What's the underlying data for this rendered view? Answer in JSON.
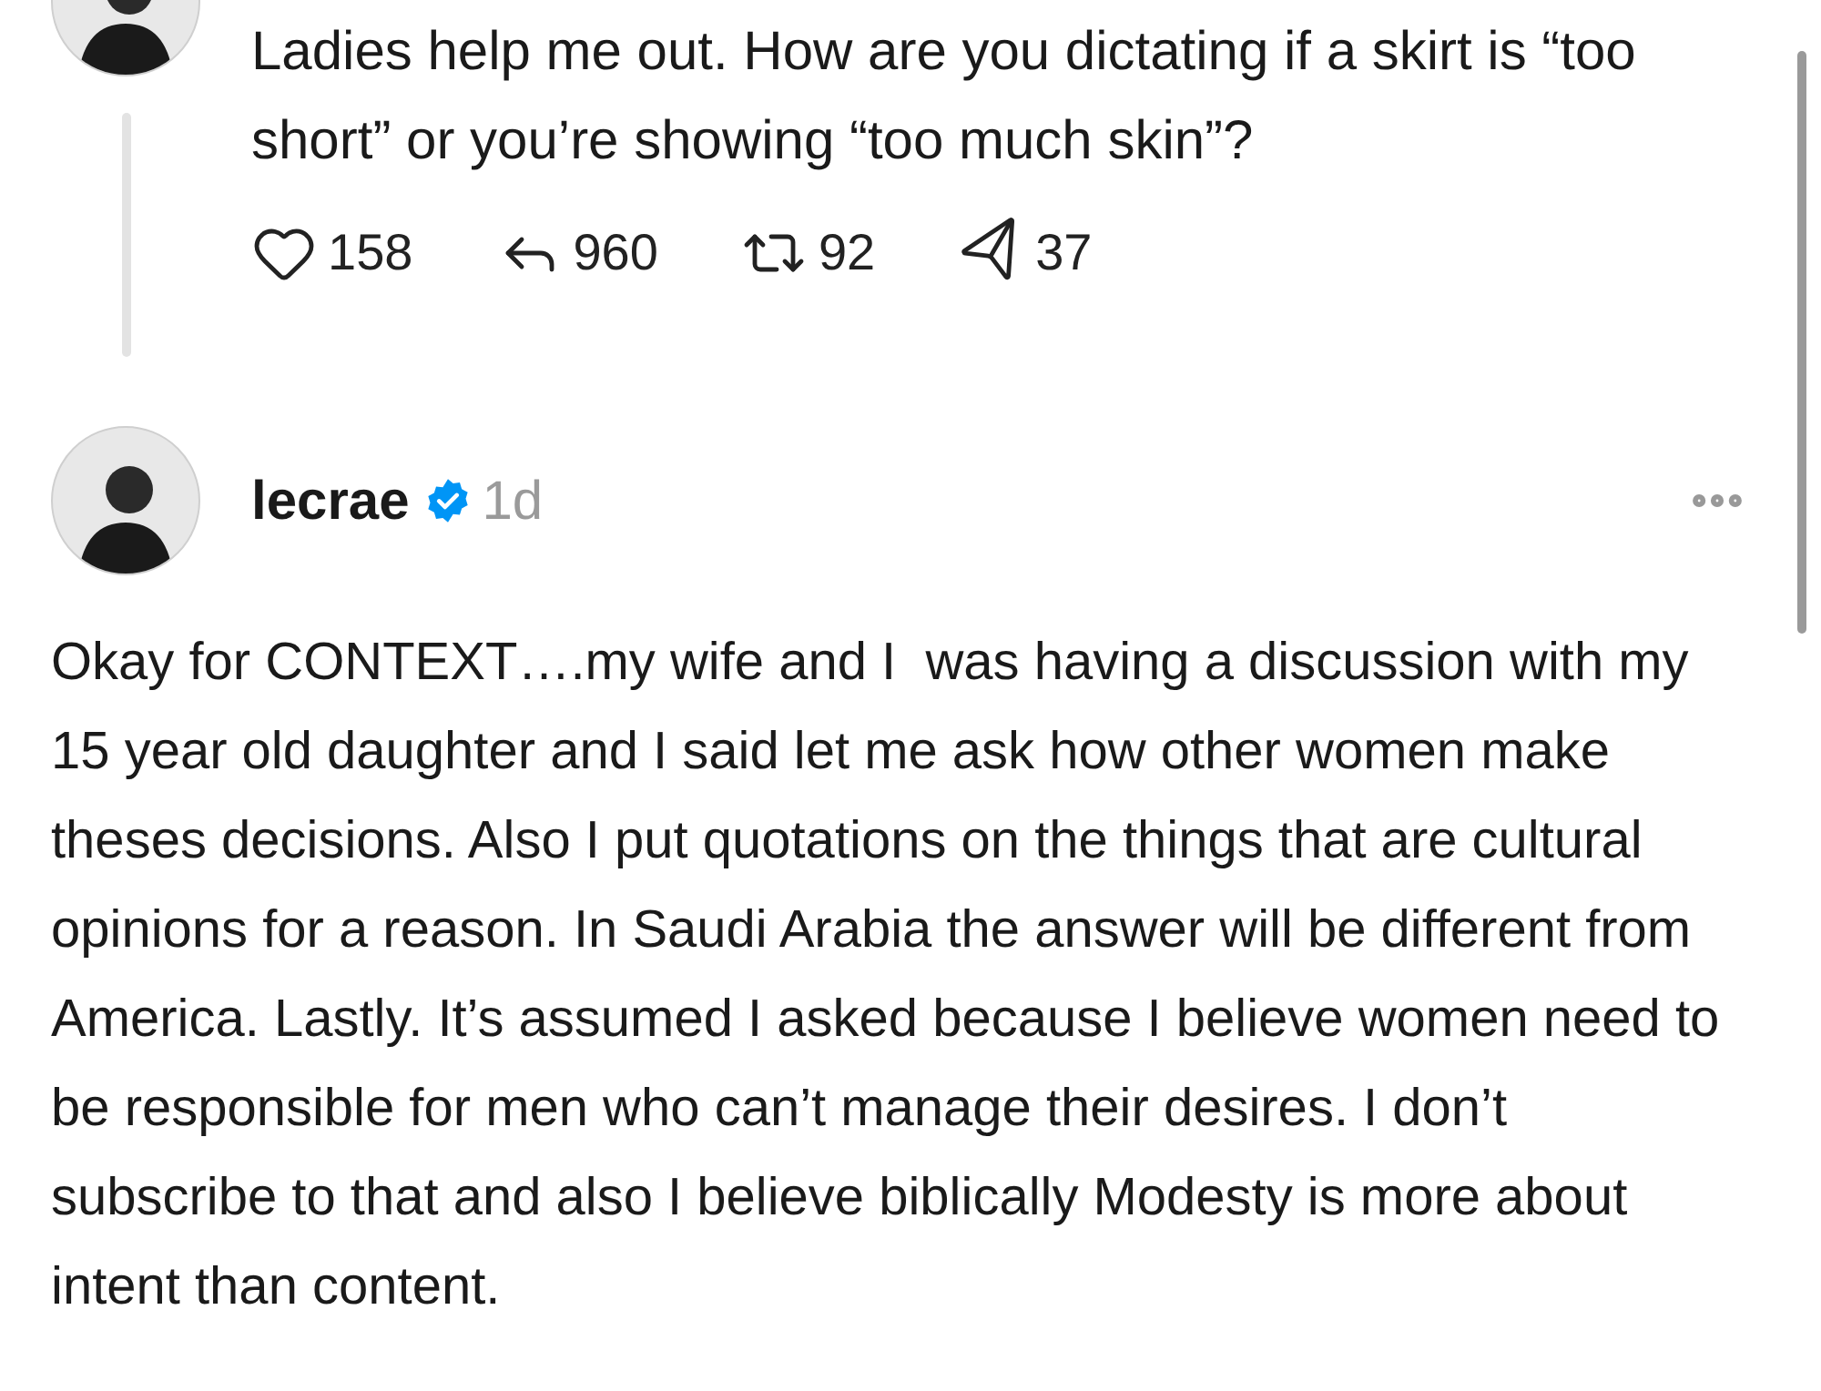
{
  "parent_post": {
    "text": "Ladies help me out. How are you dictating if a skirt is “too short” or you’re showing “too much skin”?",
    "actions": [
      {
        "kind": "like",
        "count": "158"
      },
      {
        "kind": "reply",
        "count": "960"
      },
      {
        "kind": "repost",
        "count": "92"
      },
      {
        "kind": "share",
        "count": "37"
      }
    ]
  },
  "reply_post": {
    "username": "lecrae",
    "verified": true,
    "time": "1d",
    "text": "Okay for CONTEXT….my wife and I  was having a discussion with my 15 year old daughter and I said let me ask how other women make theses decisions. Also I put quotations on the things that are cultural opinions for a reason. In Saudi Arabia the answer will be different from America. Lastly. It’s assumed I asked because I believe women need to be responsible for men who can’t manage their desires. I don’t subscribe to that and also I believe biblically Modesty is more about intent than content."
  }
}
